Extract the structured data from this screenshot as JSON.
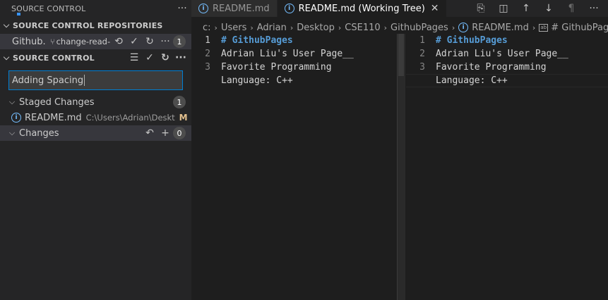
{
  "sidebar": {
    "title": "SOURCE CONTROL",
    "repositories_label": "SOURCE CONTROL REPOSITORIES",
    "repo": {
      "name": "Github...",
      "branch": "change-read-r",
      "badge": "1"
    },
    "section_label": "SOURCE CONTROL",
    "commit_message": "Adding Spacing",
    "staged": {
      "label": "Staged Changes",
      "count": "1",
      "files": [
        {
          "name": "README.md",
          "path": "C:\\Users\\Adrian\\Deskt...",
          "status": "M"
        }
      ]
    },
    "changes": {
      "label": "Changes",
      "count": "0"
    }
  },
  "tabs": [
    {
      "label": "README.md",
      "active": false
    },
    {
      "label": "README.md (Working Tree)",
      "active": true
    }
  ],
  "breadcrumb": {
    "items": [
      "c:",
      "Users",
      "Adrian",
      "Desktop",
      "CSE110",
      "GithubPages"
    ],
    "file": "README.md",
    "symbol": "# GithubPages"
  },
  "left_pane": {
    "lines": [
      {
        "num": "1",
        "text": "# GithubPages"
      },
      {
        "num": "2",
        "text": "Adrian Liu's User Page__"
      },
      {
        "num": "3",
        "text": "Favorite Programming"
      },
      {
        "num": "",
        "text": "Language: C++"
      }
    ]
  },
  "right_pane": {
    "lines": [
      {
        "num": "1",
        "text": "# GithubPages"
      },
      {
        "num": "2",
        "text": "Adrian Liu's User Page__"
      },
      {
        "num": "3",
        "text": "Favorite Programming"
      },
      {
        "num": "",
        "text": "Language: C++"
      }
    ]
  },
  "colors": {
    "accent": "#007fd4",
    "heading": "#569cd6",
    "modified": "#e2c08d",
    "info": "#75beff"
  }
}
